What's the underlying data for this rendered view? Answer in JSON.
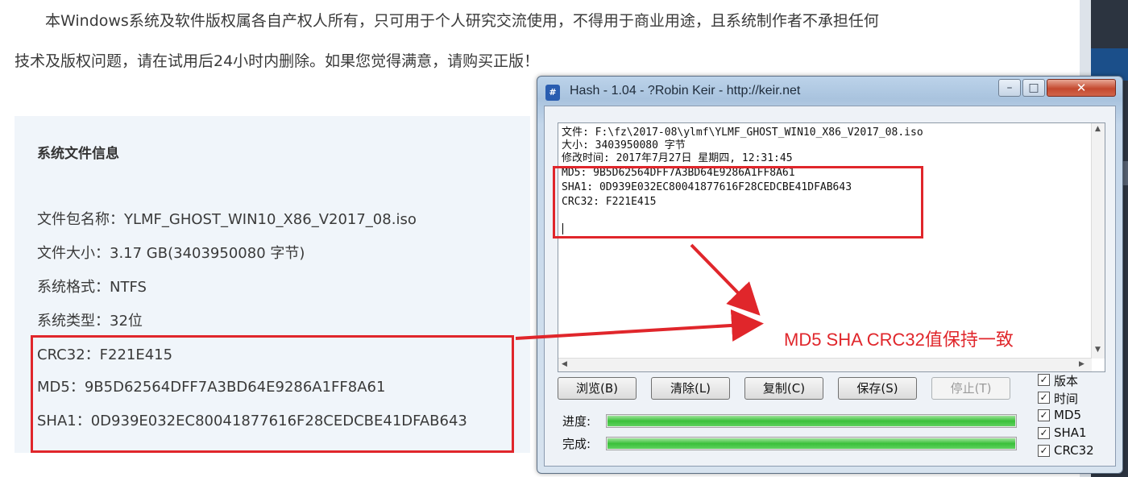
{
  "article": {
    "notice_line1": "本Windows系统及软件版权属各自产权人所有，只可用于个人研究交流使用，不得用于商业用途，且系统制作者不承担任何",
    "notice_line2": "技术及版权问题，请在试用后24小时内删除。如果您觉得满意，请购买正版！"
  },
  "file_info": {
    "title": "系统文件信息",
    "rows": [
      "文件包名称：YLMF_GHOST_WIN10_X86_V2017_08.iso",
      "文件大小：3.17 GB(3403950080 字节)",
      "系统格式：NTFS",
      "系统类型：32位",
      "CRC32：F221E415",
      "MD5：9B5D62564DFF7A3BD64E9286A1FF8A61",
      "SHA1：0D939E032EC80041877616F28CEDCBE41DFAB643"
    ]
  },
  "hash_window": {
    "title": "Hash - 1.04 - ?Robin Keir - http://keir.net",
    "output_lines": [
      "文件: F:\\fz\\2017-08\\ylmf\\YLMF_GHOST_WIN10_X86_V2017_08.iso",
      "大小: 3403950080 字节",
      "修改时间: 2017年7月27日 星期四, 12:31:45",
      "MD5: 9B5D62564DFF7A3BD64E9286A1FF8A61",
      "SHA1: 0D939E032EC80041877616F28CEDCBE41DFAB643",
      "CRC32: F221E415"
    ],
    "buttons": {
      "browse": "浏览(B)",
      "clear": "清除(L)",
      "copy": "复制(C)",
      "save": "保存(S)",
      "stop": "停止(T)"
    },
    "progress_label": "进度:",
    "complete_label": "完成:",
    "progress_fraction": 1.0,
    "complete_fraction": 1.0,
    "checkboxes": [
      {
        "label": "版本",
        "checked": true
      },
      {
        "label": "时间",
        "checked": true
      },
      {
        "label": "MD5",
        "checked": true
      },
      {
        "label": "SHA1",
        "checked": true
      },
      {
        "label": "CRC32",
        "checked": true
      }
    ]
  },
  "annotation": {
    "text": "MD5 SHA CRC32值保持一致",
    "color": "#e0262b"
  },
  "colors": {
    "accent_red": "#e0262b",
    "panel_bg": "#f0f5fa",
    "progress_green": "#3ac03a"
  }
}
